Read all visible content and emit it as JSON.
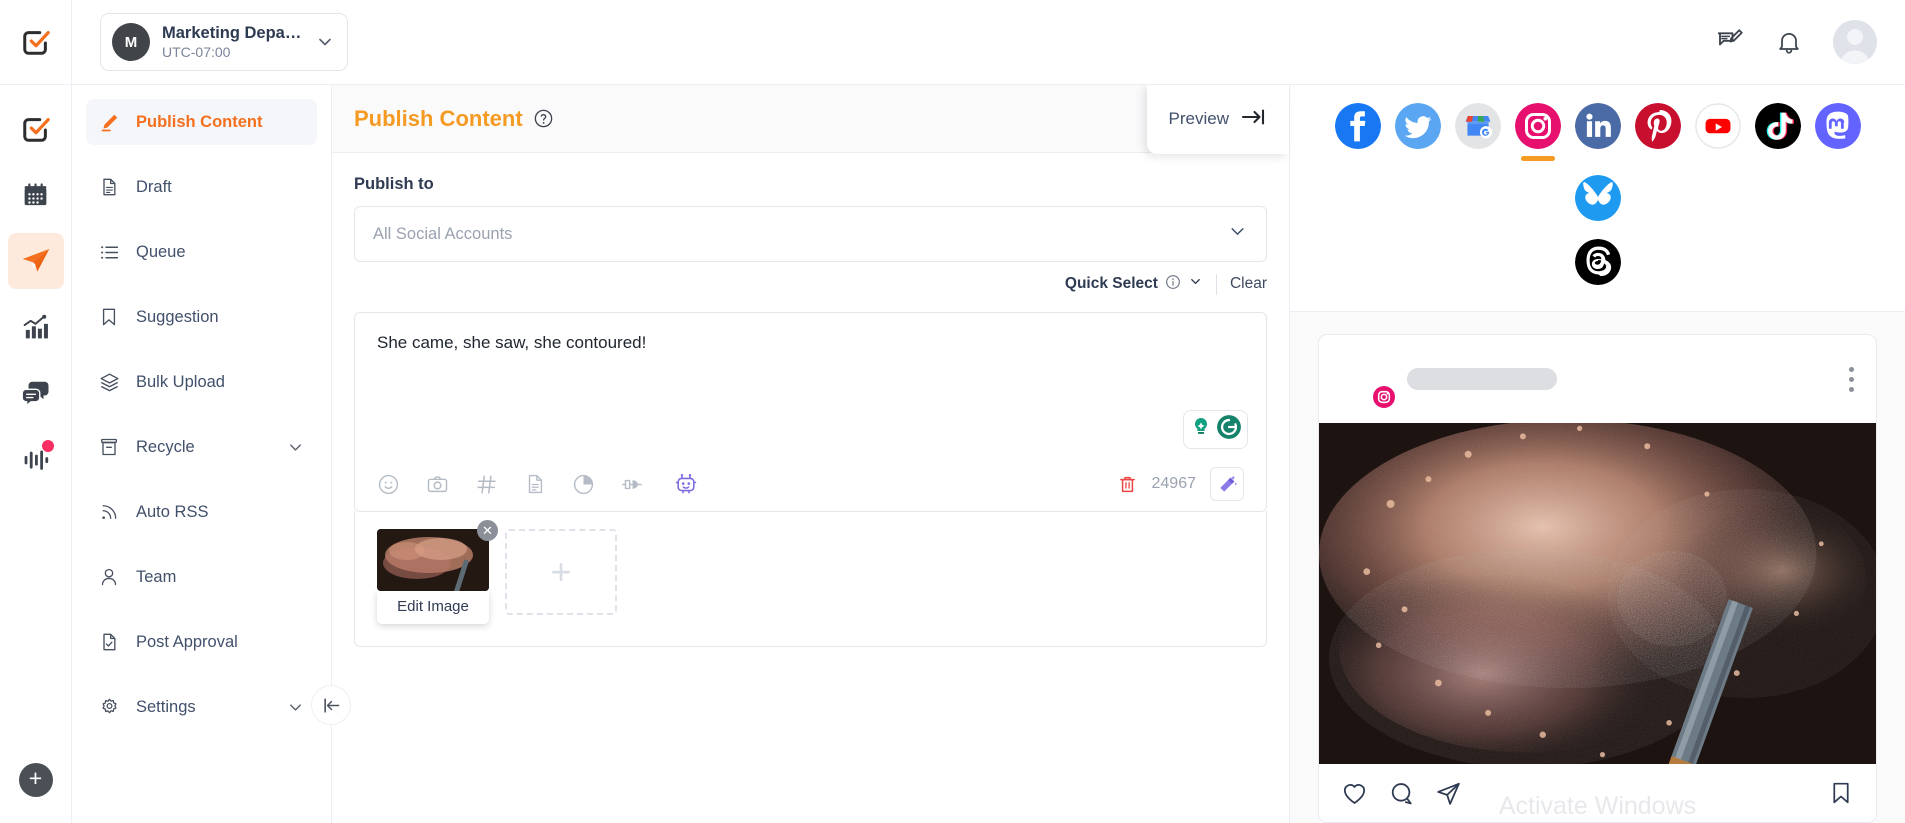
{
  "topbar": {
    "workspace": {
      "avatar_letter": "M",
      "name": "Marketing Departm…",
      "timezone": "UTC-07:00"
    },
    "icons": {
      "feedback": "feedback-edit-icon",
      "notifications": "bell-icon",
      "profile": "avatar"
    }
  },
  "rail": {
    "items": [
      {
        "name": "logo",
        "label": "Logo"
      },
      {
        "name": "calendar",
        "label": "Calendar"
      },
      {
        "name": "publish",
        "label": "Publish"
      },
      {
        "name": "analytics",
        "label": "Analytics"
      },
      {
        "name": "inbox",
        "label": "Inbox"
      },
      {
        "name": "listening",
        "label": "Listening"
      }
    ],
    "add_label": "+"
  },
  "sidebar": {
    "items": [
      {
        "label": "Publish Content",
        "icon": "pencil-icon",
        "active": true,
        "chevron": false
      },
      {
        "label": "Draft",
        "icon": "document-icon",
        "active": false,
        "chevron": false
      },
      {
        "label": "Queue",
        "icon": "list-icon",
        "active": false,
        "chevron": false
      },
      {
        "label": "Suggestion",
        "icon": "bookmark-icon",
        "active": false,
        "chevron": false
      },
      {
        "label": "Bulk Upload",
        "icon": "layers-icon",
        "active": false,
        "chevron": false
      },
      {
        "label": "Recycle",
        "icon": "archive-icon",
        "active": false,
        "chevron": true
      },
      {
        "label": "Auto RSS",
        "icon": "rss-icon",
        "active": false,
        "chevron": false
      },
      {
        "label": "Team",
        "icon": "user-icon",
        "active": false,
        "chevron": false
      },
      {
        "label": "Post Approval",
        "icon": "document-check-icon",
        "active": false,
        "chevron": false
      },
      {
        "label": "Settings",
        "icon": "gear-icon",
        "active": false,
        "chevron": true
      }
    ],
    "collapse_icon": "collapse-left-icon"
  },
  "composer": {
    "title": "Publish Content",
    "help_icon": "question-circle-icon",
    "publish_to_label": "Publish to",
    "account_select_value": "All Social Accounts",
    "quick_select_label": "Quick Select",
    "clear_label": "Clear",
    "post_text": "She came, she saw, she contoured!",
    "character_count": "24967",
    "toolbar_icons": [
      "emoji-icon",
      "camera-icon",
      "hashtag-icon",
      "document-icon",
      "pie-chart-icon",
      "plug-icon",
      "ai-robot-icon"
    ],
    "grammarly": {
      "assistant_icon": "grammarly-suggestion-icon",
      "logo_icon": "grammarly-logo-icon"
    },
    "delete_icon": "trash-icon",
    "magic_icon": "magic-wand-icon",
    "media": {
      "edit_image_label": "Edit Image",
      "remove_icon": "close-icon",
      "add_icon": "plus-icon"
    },
    "preview_button": {
      "label": "Preview",
      "icon": "arrow-to-line-icon"
    }
  },
  "preview": {
    "networks": [
      {
        "name": "facebook",
        "label": "Facebook",
        "active": false
      },
      {
        "name": "twitter",
        "label": "Twitter",
        "active": false
      },
      {
        "name": "google-business",
        "label": "Google Business",
        "active": false
      },
      {
        "name": "instagram",
        "label": "Instagram",
        "active": true
      },
      {
        "name": "linkedin",
        "label": "LinkedIn",
        "active": false
      },
      {
        "name": "pinterest",
        "label": "Pinterest",
        "active": false
      },
      {
        "name": "youtube",
        "label": "YouTube",
        "active": false
      },
      {
        "name": "tiktok",
        "label": "TikTok",
        "active": false
      },
      {
        "name": "mastodon",
        "label": "Mastodon",
        "active": false
      },
      {
        "name": "bluesky",
        "label": "Bluesky",
        "active": false
      }
    ],
    "networks_row2": [
      {
        "name": "threads",
        "label": "Threads",
        "active": false
      }
    ],
    "post_card": {
      "platform_badge": "instagram-badge-icon",
      "menu_icon": "more-options-icon",
      "actions": [
        "heart-icon",
        "comment-icon",
        "share-icon",
        "bookmark-icon"
      ]
    },
    "watermark": "Activate Windows"
  },
  "colors": {
    "accent_orange": "#f4701f",
    "title_orange": "#f59a22",
    "text_dark": "#2f3b52",
    "instagram_pink": "#e8106f",
    "grammarly_green": "#15836c"
  }
}
